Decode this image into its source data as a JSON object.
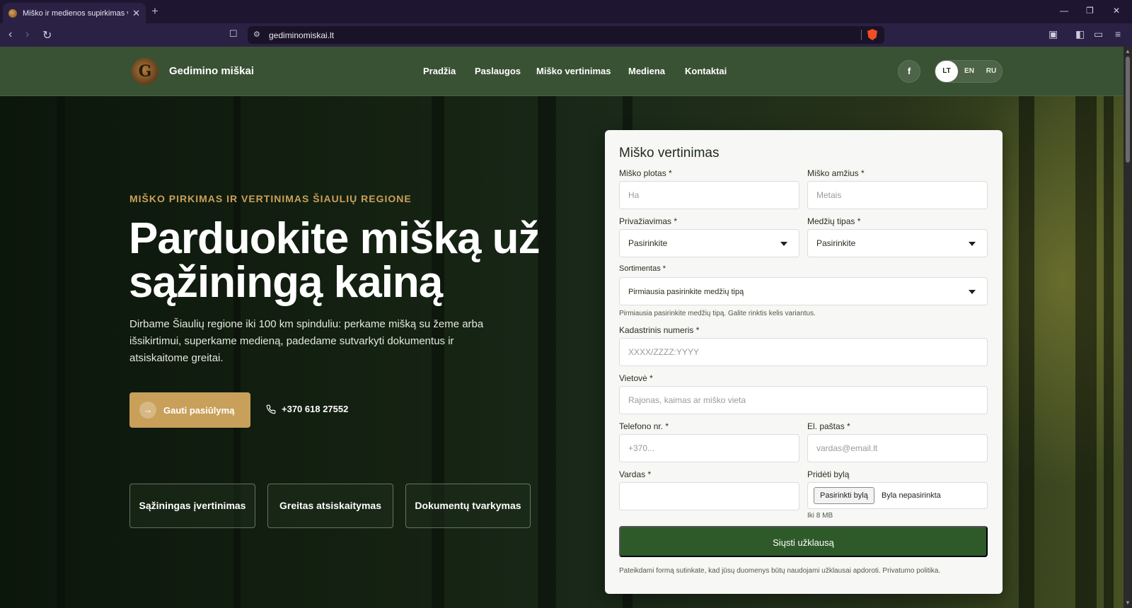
{
  "browser": {
    "tab_title": "Miško ir medienos supirkimas vis",
    "url": "gediminomiskai.lt"
  },
  "header": {
    "logo_letter": "G",
    "site_name": "Gedimino miškai",
    "nav": [
      "Pradžia",
      "Paslaugos",
      "Miško vertinimas",
      "Mediena",
      "Kontaktai"
    ],
    "facebook": "f",
    "languages": [
      "LT",
      "EN",
      "RU"
    ],
    "active_language": "LT"
  },
  "hero": {
    "eyebrow": "MIŠKO PIRKIMAS IR VERTINIMAS ŠIAULIŲ REGIONE",
    "title": "Parduokite mišką už sąžiningą kainą",
    "description": "Dirbame Šiaulių regione iki 100 km spinduliu: perkame mišką su žeme arba išsikirtimui, superkame medieną, padedame sutvarkyti dokumentus ir atsiskaitome greitai.",
    "cta_label": "Gauti pasiūlymą",
    "phone": "+370 618 27552",
    "features": [
      "Sąžiningas įvertinimas",
      "Greitas atsiskaitymas",
      "Dokumentų tvarkymas"
    ]
  },
  "form": {
    "title": "Miško vertinimas",
    "area_label": "Miško plotas *",
    "area_placeholder": "Ha",
    "age_label": "Miško amžius *",
    "age_placeholder": "Metais",
    "access_label": "Privažiavimas *",
    "access_value": "Pasirinkite",
    "tree_type_label": "Medžių tipas *",
    "tree_type_value": "Pasirinkite",
    "assortment_label": "Sortimentas *",
    "assortment_value": "Pirmiausia pasirinkite medžių tipą",
    "assortment_hint": "Pirmiausia pasirinkite medžių tipą. Galite rinktis kelis variantus.",
    "cadastral_label": "Kadastrinis numeris *",
    "cadastral_placeholder": "XXXX/ZZZZ:YYYY",
    "location_label": "Vietovė *",
    "location_placeholder": "Rajonas, kaimas ar miško vieta",
    "phone_label": "Telefono nr. *",
    "phone_placeholder": "+370...",
    "email_label": "El. paštas *",
    "email_placeholder": "vardas@email.lt",
    "name_label": "Vardas *",
    "name_value": "",
    "file_label": "Pridėti bylą",
    "file_button": "Pasirinkti bylą",
    "file_status": "Byla nepasirinkta",
    "file_hint": "Iki 8 MB",
    "submit_label": "Siųsti užklausą",
    "consent": "Pateikdami formą sutinkate, kad jūsų duomenys būtų naudojami užklausai apdoroti. Privatumo politika."
  }
}
